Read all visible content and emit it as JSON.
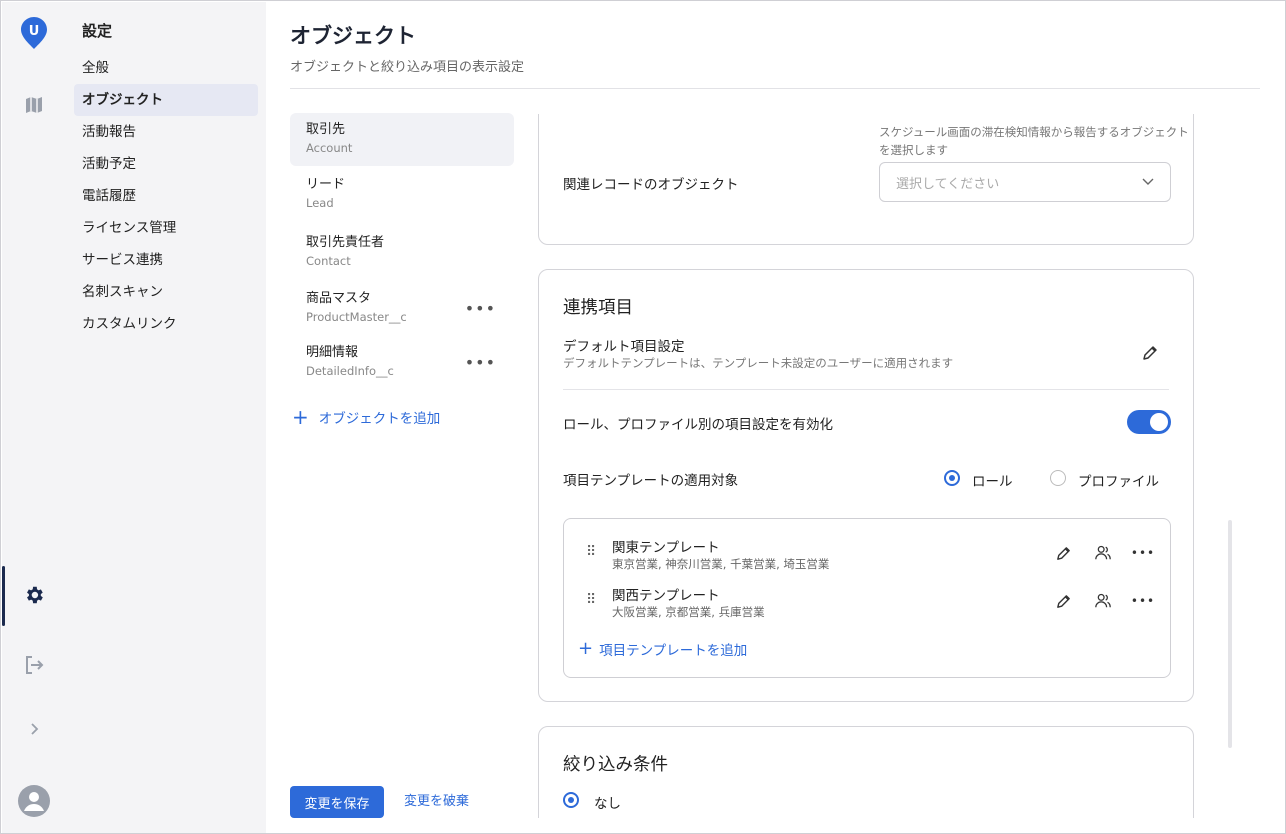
{
  "rail": {
    "logo_letter": "U",
    "accent": "#2d6ad9",
    "icons": [
      "logo-icon",
      "map-icon",
      "settings-icon",
      "logout-icon",
      "chevron-right-icon",
      "user-avatar-icon"
    ]
  },
  "sidebar": {
    "title": "設定",
    "items": [
      "全般",
      "オブジェクト",
      "活動報告",
      "活動予定",
      "電話履歴",
      "ライセンス管理",
      "サービス連携",
      "名刺スキャン",
      "カスタムリンク"
    ],
    "selected": "オブジェクト"
  },
  "header": {
    "title": "オブジェクト",
    "subtitle": "オブジェクトと絞り込み項目の表示設定"
  },
  "objects": {
    "items": [
      {
        "name": "取引先",
        "api": "Account"
      },
      {
        "name": "リード",
        "api": "Lead"
      },
      {
        "name": "取引先責任者",
        "api": "Contact"
      },
      {
        "name": "商品マスタ",
        "api": "ProductMaster__c"
      },
      {
        "name": "明細情報",
        "api": "DetailedInfo__c"
      }
    ],
    "add_label": "オブジェクトを追加"
  },
  "footer": {
    "save": "変更を保存",
    "discard": "変更を破棄"
  },
  "card1": {
    "note": "スケジュール画面の滞在検知情報から報告するオブジェクトを選択します",
    "related_label": "関連レコードのオブジェクト",
    "select_placeholder": "選択してください"
  },
  "card2": {
    "title": "連携項目",
    "default_title": "デフォルト項目設定",
    "default_desc": "デフォルトテンプレートは、テンプレート未設定のユーザーに適用されます",
    "toggle_label": "ロール、プロファイル別の項目設定を有効化",
    "toggle_on": true,
    "apply_label": "項目テンプレートの適用対象",
    "radio_role": "ロール",
    "radio_profile": "プロファイル",
    "radio_selected": "ロール",
    "templates": [
      {
        "name": "関東テンプレート",
        "members": "東京営業, 神奈川営業, 千葉営業, 埼玉営業"
      },
      {
        "name": "関西テンプレート",
        "members": "大阪営業, 京都営業, 兵庫営業"
      }
    ],
    "add_template": "項目テンプレートを追加"
  },
  "card3": {
    "title": "絞り込み条件",
    "option_none": "なし"
  }
}
